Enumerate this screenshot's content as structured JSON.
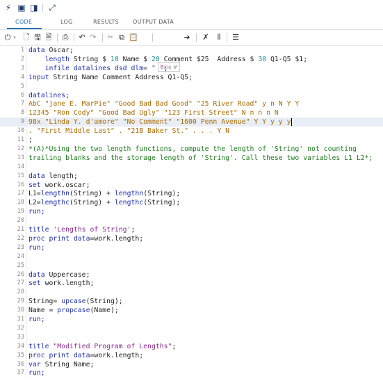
{
  "tabs": [
    {
      "label": "CODE"
    },
    {
      "label": "LOG"
    },
    {
      "label": "RESULTS"
    },
    {
      "label": "OUTPUT DATA"
    }
  ],
  "toolbar": {
    "line_input_placeholder": "Line #"
  },
  "editor": {
    "lines": [
      {
        "n": "1",
        "t": [
          {
            "c": "kw",
            "s": "data "
          },
          {
            "c": "",
            "s": "Oscar;"
          }
        ]
      },
      {
        "n": "2",
        "t": [
          {
            "c": "",
            "s": "    "
          },
          {
            "c": "kw",
            "s": "length"
          },
          {
            "c": "",
            "s": " String $ "
          },
          {
            "c": "num",
            "s": "10"
          },
          {
            "c": "",
            "s": " Name $ "
          },
          {
            "c": "num",
            "s": "20"
          },
          {
            "c": "",
            "s": " Comment $25  Address $ "
          },
          {
            "c": "num",
            "s": "30"
          },
          {
            "c": "",
            "s": " Q1-Q5 $1;"
          }
        ]
      },
      {
        "n": "3",
        "t": [
          {
            "c": "",
            "s": "    "
          },
          {
            "c": "kw",
            "s": "infile datalines dsd dlm"
          },
          {
            "c": "",
            "s": "= "
          },
          {
            "c": "str",
            "s": "\" \""
          },
          {
            "c": "",
            "s": ";"
          }
        ]
      },
      {
        "n": "4",
        "t": [
          {
            "c": "kw",
            "s": "input"
          },
          {
            "c": "",
            "s": " String Name Comment Address Q1-Q5;"
          }
        ]
      },
      {
        "n": "5",
        "t": []
      },
      {
        "n": "6",
        "t": [
          {
            "c": "kw",
            "s": "datalines;"
          }
        ]
      },
      {
        "n": "7",
        "t": [
          {
            "c": "dat",
            "s": "AbC \"jane E. MarPie\" \"Good Bad Bad Good\" \"25 River Road\" y n N Y Y"
          }
        ]
      },
      {
        "n": "8",
        "t": [
          {
            "c": "dat",
            "s": "12345 \"Ron Cody\" \"Good Bad Ugly\" \"123 First Street\" N n n n N"
          }
        ]
      },
      {
        "n": "9",
        "t": [
          {
            "c": "dat",
            "s": "98x \"Linda Y. d'amore\" \"No Comment\" \"1600 Penn Avenue\" Y Y y y y"
          }
        ],
        "current": true
      },
      {
        "n": "10",
        "t": [
          {
            "c": "dat",
            "s": ". \"First Middle Last\" . \"21B Baker St.\" . . . Y N"
          }
        ]
      },
      {
        "n": "11",
        "t": [
          {
            "c": "",
            "s": ";"
          }
        ]
      },
      {
        "n": "12",
        "t": [
          {
            "c": "com",
            "s": "*(A)*Using the two length functions, compute the length of 'String' not counting"
          }
        ]
      },
      {
        "n": "13",
        "t": [
          {
            "c": "com",
            "s": "trailing blanks and the storage length of 'String'. Call these two variables L1 L2*;"
          }
        ]
      },
      {
        "n": "14",
        "t": []
      },
      {
        "n": "15",
        "t": [
          {
            "c": "kw",
            "s": "data "
          },
          {
            "c": "",
            "s": "length;"
          }
        ]
      },
      {
        "n": "16",
        "t": [
          {
            "c": "kw",
            "s": "set "
          },
          {
            "c": "",
            "s": "work.oscar;"
          }
        ]
      },
      {
        "n": "17",
        "t": [
          {
            "c": "",
            "s": "L1="
          },
          {
            "c": "kw",
            "s": "lengthn"
          },
          {
            "c": "",
            "s": "(String) + "
          },
          {
            "c": "kw",
            "s": "lengthn"
          },
          {
            "c": "",
            "s": "(String);"
          }
        ]
      },
      {
        "n": "18",
        "t": [
          {
            "c": "",
            "s": "L2="
          },
          {
            "c": "kw",
            "s": "lengthc"
          },
          {
            "c": "",
            "s": "(String) + "
          },
          {
            "c": "kw",
            "s": "lengthc"
          },
          {
            "c": "",
            "s": "(String);"
          }
        ]
      },
      {
        "n": "19",
        "t": [
          {
            "c": "kw",
            "s": "run;"
          }
        ]
      },
      {
        "n": "20",
        "t": []
      },
      {
        "n": "21",
        "t": [
          {
            "c": "kw",
            "s": "title "
          },
          {
            "c": "str",
            "s": "'Lengths of String'"
          },
          {
            "c": "",
            "s": ";"
          }
        ]
      },
      {
        "n": "22",
        "t": [
          {
            "c": "kw",
            "s": "proc print data"
          },
          {
            "c": "",
            "s": "=work.length;"
          }
        ]
      },
      {
        "n": "23",
        "t": [
          {
            "c": "kw",
            "s": "run;"
          }
        ]
      },
      {
        "n": "24",
        "t": []
      },
      {
        "n": "25",
        "t": []
      },
      {
        "n": "26",
        "t": [
          {
            "c": "kw",
            "s": "data "
          },
          {
            "c": "",
            "s": "Uppercase;"
          }
        ]
      },
      {
        "n": "27",
        "t": [
          {
            "c": "kw",
            "s": "set "
          },
          {
            "c": "",
            "s": "work.length;"
          }
        ]
      },
      {
        "n": "28",
        "t": []
      },
      {
        "n": "29",
        "t": [
          {
            "c": "",
            "s": "String= "
          },
          {
            "c": "kw",
            "s": "upcase"
          },
          {
            "c": "",
            "s": "(String);"
          }
        ]
      },
      {
        "n": "30",
        "t": [
          {
            "c": "",
            "s": "Name = "
          },
          {
            "c": "kw",
            "s": "propcase"
          },
          {
            "c": "",
            "s": "(Name);"
          }
        ]
      },
      {
        "n": "31",
        "t": [
          {
            "c": "kw",
            "s": "run;"
          }
        ]
      },
      {
        "n": "32",
        "t": []
      },
      {
        "n": "33",
        "t": []
      },
      {
        "n": "34",
        "t": [
          {
            "c": "kw",
            "s": "title "
          },
          {
            "c": "str",
            "s": "\"Modified Program of Lengths\""
          },
          {
            "c": "",
            "s": ";"
          }
        ]
      },
      {
        "n": "35",
        "t": [
          {
            "c": "kw",
            "s": "proc print data"
          },
          {
            "c": "",
            "s": "=work.length;"
          }
        ]
      },
      {
        "n": "36",
        "t": [
          {
            "c": "kw",
            "s": "var "
          },
          {
            "c": "",
            "s": "String Name;"
          }
        ]
      },
      {
        "n": "37",
        "t": [
          {
            "c": "kw",
            "s": "run;"
          }
        ]
      }
    ]
  }
}
